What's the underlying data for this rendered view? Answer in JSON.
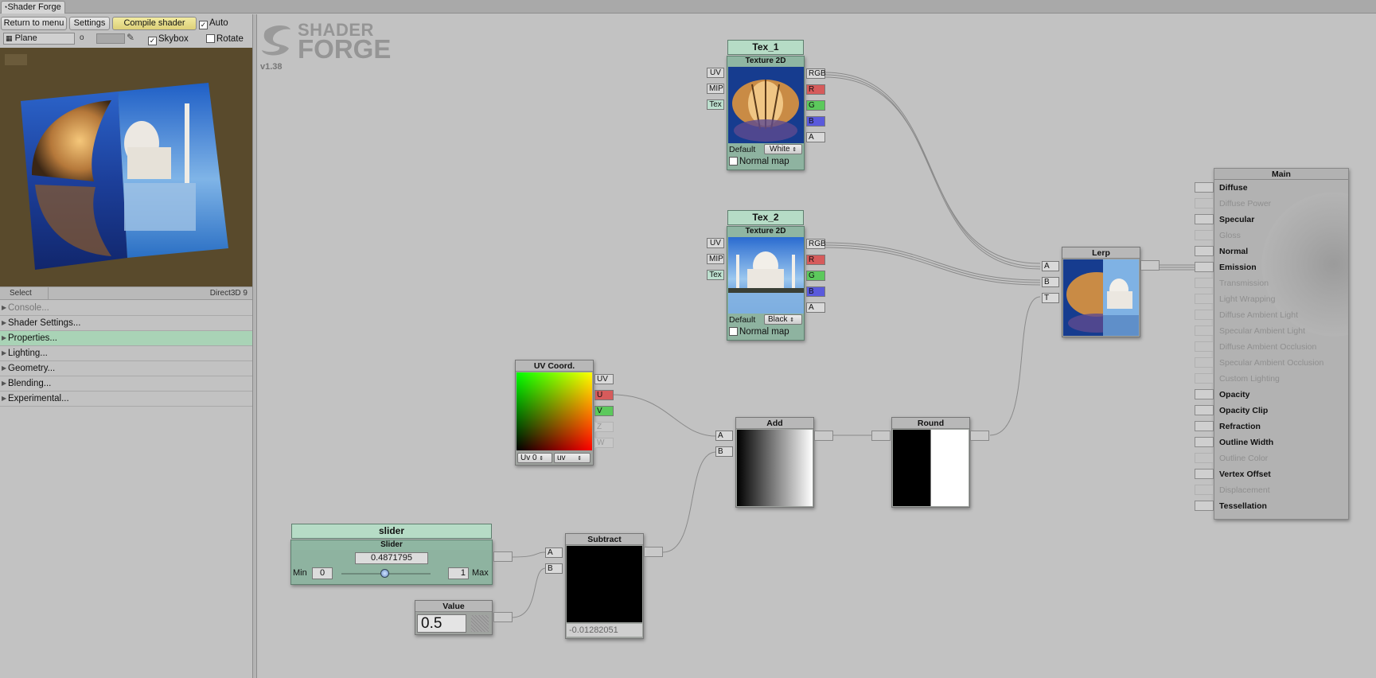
{
  "window": {
    "tab_title": "Shader Forge"
  },
  "toolbar": {
    "return_label": "Return to menu",
    "settings_label": "Settings",
    "compile_label": "Compile shader",
    "auto_label": "Auto",
    "auto_checked": true
  },
  "preview_bar": {
    "mesh_label": "Plane",
    "skybox_label": "Skybox",
    "skybox_checked": true,
    "rotate_label": "Rotate",
    "rotate_checked": false
  },
  "status": {
    "select_label": "Select",
    "renderer": "Direct3D 9"
  },
  "sections": [
    {
      "label": "Console...",
      "state": "dim"
    },
    {
      "label": "Shader Settings...",
      "state": "normal"
    },
    {
      "label": "Properties...",
      "state": "active"
    },
    {
      "label": "Lighting...",
      "state": "normal"
    },
    {
      "label": "Geometry...",
      "state": "normal"
    },
    {
      "label": "Blending...",
      "state": "normal"
    },
    {
      "label": "Experimental...",
      "state": "normal"
    }
  ],
  "logo": {
    "line1": "SHADER",
    "line2": "FORGE",
    "version": "v1.38"
  },
  "nodes": {
    "tex1": {
      "name": "Tex_1",
      "type": "Texture 2D",
      "inputs": [
        "UV",
        "MIP",
        "Tex"
      ],
      "outputs": [
        "RGB",
        "R",
        "G",
        "B",
        "A"
      ],
      "default_label": "Default",
      "default_value": "White",
      "normal_map_label": "Normal map"
    },
    "tex2": {
      "name": "Tex_2",
      "type": "Texture 2D",
      "inputs": [
        "UV",
        "MIP",
        "Tex"
      ],
      "outputs": [
        "RGB",
        "R",
        "G",
        "B",
        "A"
      ],
      "default_label": "Default",
      "default_value": "Black",
      "normal_map_label": "Normal map"
    },
    "uv": {
      "title": "UV Coord.",
      "outputs": [
        "UV",
        "U",
        "V",
        "Z",
        "W"
      ],
      "channel": "Uv 0",
      "mode": "uv"
    },
    "add": {
      "title": "Add",
      "inputs": [
        "A",
        "B"
      ]
    },
    "round": {
      "title": "Round"
    },
    "lerp": {
      "title": "Lerp",
      "inputs": [
        "A",
        "B",
        "T"
      ]
    },
    "slider": {
      "name": "slider",
      "type": "Slider",
      "value": "0.4871795",
      "min_label": "Min",
      "min": "0",
      "max": "1",
      "max_label": "Max",
      "position": 0.4871795
    },
    "value": {
      "title": "Value",
      "value": "0.5"
    },
    "subtract": {
      "title": "Subtract",
      "inputs": [
        "A",
        "B"
      ],
      "result": "-0.01282051"
    }
  },
  "main_node": {
    "title": "Main",
    "inputs": [
      {
        "label": "Diffuse",
        "enabled": true
      },
      {
        "label": "Diffuse Power",
        "enabled": false
      },
      {
        "label": "Specular",
        "enabled": true
      },
      {
        "label": "Gloss",
        "enabled": false
      },
      {
        "label": "Normal",
        "enabled": true
      },
      {
        "label": "Emission",
        "enabled": true
      },
      {
        "label": "Transmission",
        "enabled": false
      },
      {
        "label": "Light Wrapping",
        "enabled": false
      },
      {
        "label": "Diffuse Ambient Light",
        "enabled": false
      },
      {
        "label": "Specular Ambient Light",
        "enabled": false
      },
      {
        "label": "Diffuse Ambient Occlusion",
        "enabled": false
      },
      {
        "label": "Specular Ambient Occlusion",
        "enabled": false
      },
      {
        "label": "Custom Lighting",
        "enabled": false
      },
      {
        "label": "Opacity",
        "enabled": true
      },
      {
        "label": "Opacity Clip",
        "enabled": true
      },
      {
        "label": "Refraction",
        "enabled": true
      },
      {
        "label": "Outline Width",
        "enabled": true
      },
      {
        "label": "Outline Color",
        "enabled": false
      },
      {
        "label": "Vertex Offset",
        "enabled": true
      },
      {
        "label": "Displacement",
        "enabled": false
      },
      {
        "label": "Tessellation",
        "enabled": true
      }
    ]
  },
  "colors": {
    "preview_bg": "#594a2c",
    "property_node": "#8eb3a0",
    "active_section": "#a9d3b6",
    "compile_button": "#ddd078"
  }
}
